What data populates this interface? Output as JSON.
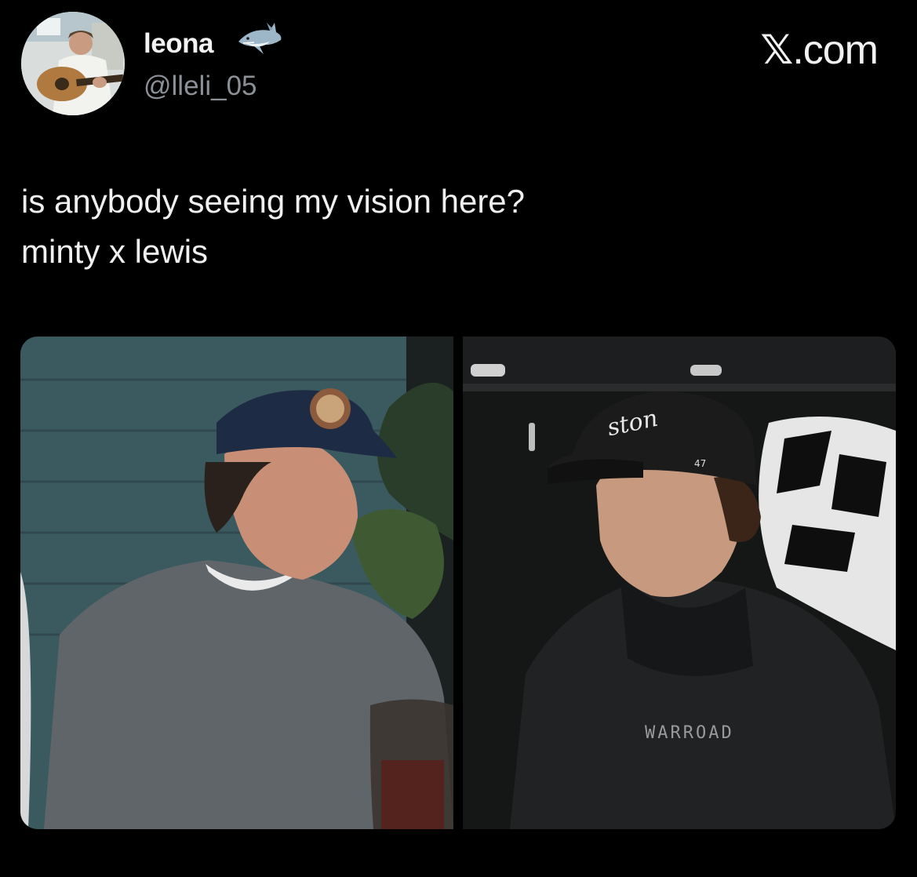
{
  "author": {
    "display_name": "leona",
    "handle": "@lleli_05",
    "badge_icon": "shark-emoji-icon"
  },
  "brand": {
    "x_glyph": "𝕏",
    "domain": ".com"
  },
  "tweet": {
    "lines": [
      "is anybody seeing my vision here?",
      "minty x lewis"
    ]
  },
  "media": {
    "right_photo_jersey_text": "WARROAD",
    "right_photo_cap_text": "ston",
    "right_photo_cap_number": "47"
  },
  "colors": {
    "background": "#000000",
    "text_primary": "#e7e9ea",
    "text_secondary": "#8b9096"
  }
}
